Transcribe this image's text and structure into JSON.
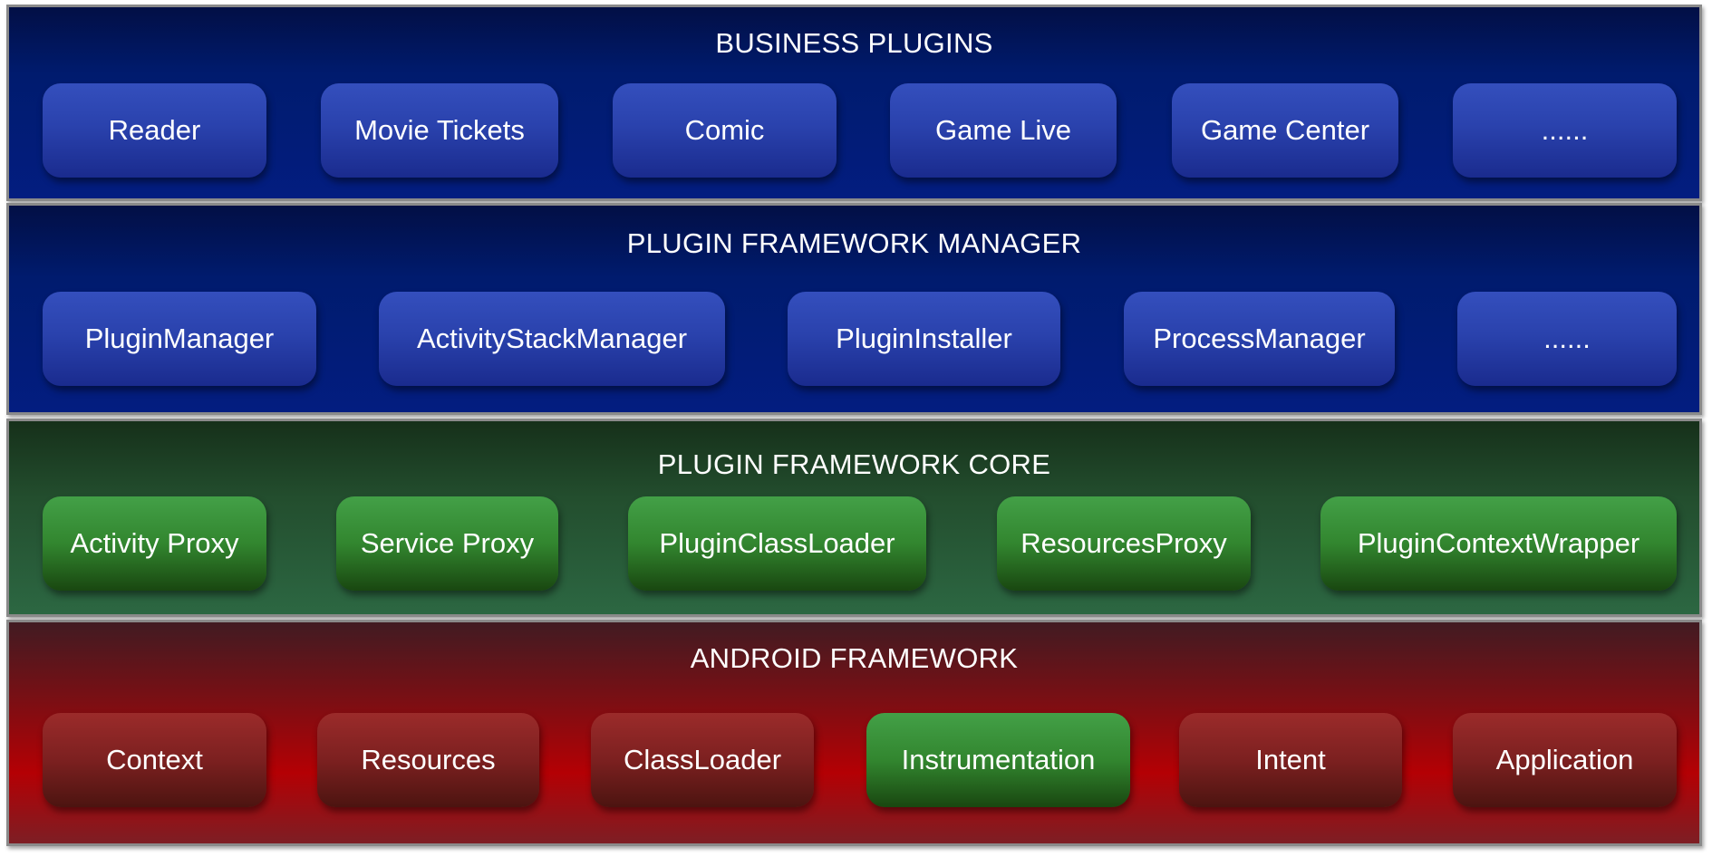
{
  "colors": {
    "business_layer": "#001b6e",
    "manager_layer": "#001b6e",
    "core_layer": "#234e2e",
    "android_layer": "#b40004",
    "blue_node": "#2a42ad",
    "green_node": "#32862f",
    "red_node": "#7c2020",
    "border": "#8a8a8a",
    "text": "#ffffff"
  },
  "layers": [
    {
      "title": "BUSINESS PLUGINS",
      "color": "blue",
      "nodes": [
        {
          "label": "Reader",
          "color": "blue"
        },
        {
          "label": "Movie Tickets",
          "color": "blue"
        },
        {
          "label": "Comic",
          "color": "blue"
        },
        {
          "label": "Game Live",
          "color": "blue"
        },
        {
          "label": "Game Center",
          "color": "blue"
        },
        {
          "label": "......",
          "color": "blue"
        }
      ]
    },
    {
      "title": "PLUGIN FRAMEWORK MANAGER",
      "color": "blue",
      "nodes": [
        {
          "label": "PluginManager",
          "color": "blue"
        },
        {
          "label": "ActivityStackManager",
          "color": "blue"
        },
        {
          "label": "PluginInstaller",
          "color": "blue"
        },
        {
          "label": "ProcessManager",
          "color": "blue"
        },
        {
          "label": "......",
          "color": "blue"
        }
      ]
    },
    {
      "title": "PLUGIN FRAMEWORK CORE",
      "color": "green",
      "nodes": [
        {
          "label": "Activity Proxy",
          "color": "green"
        },
        {
          "label": "Service Proxy",
          "color": "green"
        },
        {
          "label": "PluginClassLoader",
          "color": "green"
        },
        {
          "label": "ResourcesProxy",
          "color": "green"
        },
        {
          "label": "PluginContextWrapper",
          "color": "green"
        }
      ]
    },
    {
      "title": "ANDROID FRAMEWORK",
      "color": "red",
      "nodes": [
        {
          "label": "Context",
          "color": "red"
        },
        {
          "label": "Resources",
          "color": "red"
        },
        {
          "label": "ClassLoader",
          "color": "red"
        },
        {
          "label": "Instrumentation",
          "color": "green"
        },
        {
          "label": "Intent",
          "color": "red"
        },
        {
          "label": "Application",
          "color": "red"
        }
      ]
    }
  ]
}
